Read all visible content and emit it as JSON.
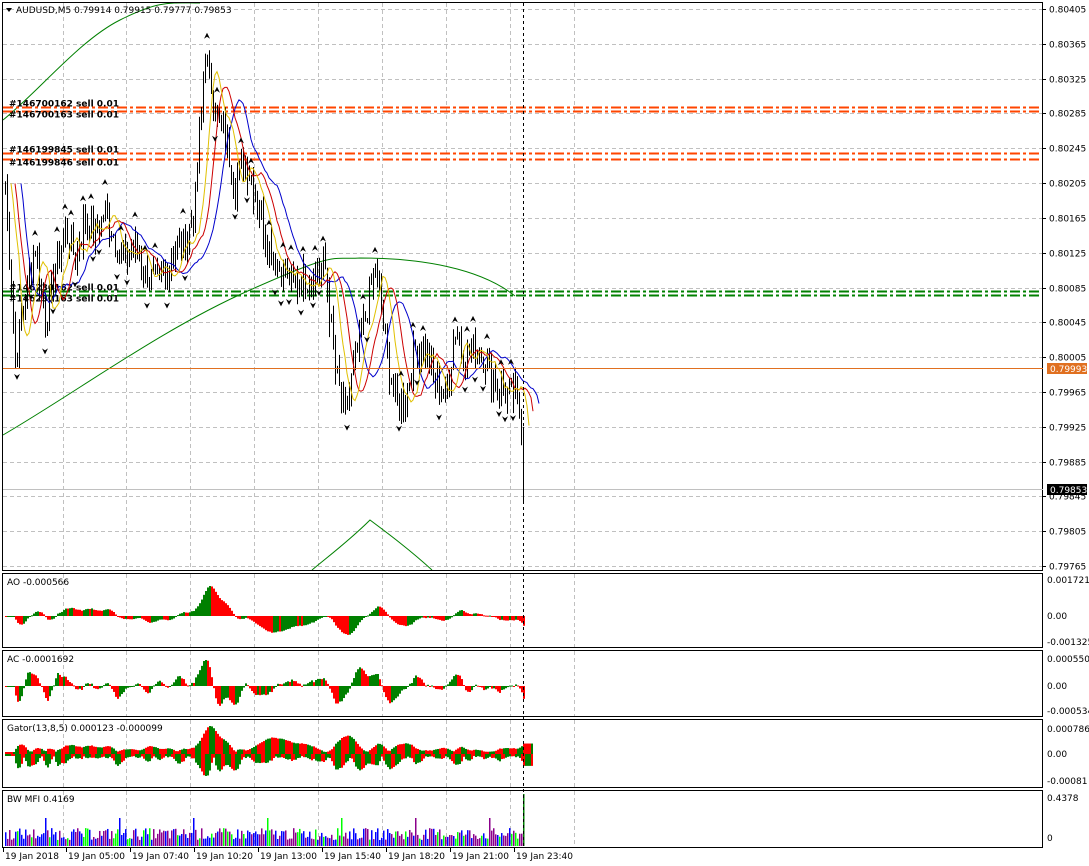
{
  "chart_data": {
    "type": "line",
    "symbol": "AUDUSD,M5",
    "title": "AUDUSD,M5  0.79914 0.79915 0.79777 0.79853",
    "ohlc": {
      "open": 0.79914,
      "high": 0.79915,
      "low": 0.79777,
      "close": 0.79853
    },
    "price_ticks": [
      "0.80405",
      "0.80365",
      "0.80325",
      "0.80285",
      "0.80245",
      "0.80205",
      "0.80165",
      "0.80125",
      "0.80085",
      "0.80045",
      "0.80005",
      "0.79965",
      "0.79925",
      "0.79885",
      "0.79845",
      "0.79805",
      "0.79765"
    ],
    "ylim": [
      0.79765,
      0.80405
    ],
    "x_ticks": [
      "19 Jan 2018",
      "19 Jan 05:00",
      "19 Jan 07:40",
      "19 Jan 10:20",
      "19 Jan 13:00",
      "19 Jan 15:40",
      "19 Jan 18:20",
      "19 Jan 21:00",
      "19 Jan 23:40"
    ],
    "current_price": {
      "label": "0.79853",
      "value": 0.79853
    },
    "order_line": {
      "label": "0.79993",
      "value": 0.79993
    },
    "order_levels": [
      {
        "label": "#146700162 sell 0.01",
        "price": 0.80292,
        "color": "#ff4500"
      },
      {
        "label": "#146700163 sell 0.01",
        "price": 0.80288,
        "color": "#ff4500"
      },
      {
        "label": "#146199845 sell 0.01",
        "price": 0.80239,
        "color": "#ff4500"
      },
      {
        "label": "#146199846 sell 0.01",
        "price": 0.80233,
        "color": "#ff4500"
      },
      {
        "label": "#146230162 sell 0.01",
        "price": 0.80081,
        "color": "#008000"
      },
      {
        "label": "#146230163 sell 0.01",
        "price": 0.80076,
        "color": "#008000"
      }
    ],
    "grid": true,
    "colors": {
      "candle": "#000000",
      "grid": "#c0c0c0",
      "ma_red": "#cc0000",
      "ma_blue": "#0000cc",
      "ma_gold": "#e0c000",
      "bands": "#008000",
      "order_line": "#e07020",
      "bull": "#008000",
      "bear": "#ff0000",
      "current_box": "#000000"
    },
    "subwindows": [
      {
        "id": "ao",
        "label": "AO -0.000566",
        "ticks": [
          "0.001721",
          "0.00",
          "-0.001325"
        ],
        "ylim": [
          -0.001325,
          0.001721
        ]
      },
      {
        "id": "ac",
        "label": "AC -0.0001692",
        "ticks": [
          "0.000550",
          "0.00",
          "-0.000534"
        ],
        "ylim": [
          -0.000534,
          0.00055
        ]
      },
      {
        "id": "gator",
        "label": "Gator(13,8,5) 0.000123 -0.000099",
        "ticks": [
          "0.000786",
          "0.00",
          "-0.00081"
        ],
        "ylim": [
          -0.00081,
          0.000786
        ]
      },
      {
        "id": "mfi",
        "label": "BW MFI 0.4169",
        "ticks": [
          "0.4378",
          "0"
        ],
        "ylim": [
          0,
          0.4378
        ]
      }
    ],
    "key_prices": [
      [
        0,
        0.80205
      ],
      [
        5,
        0.80005
      ],
      [
        10,
        0.80075
      ],
      [
        15,
        0.80135
      ],
      [
        20,
        0.80045
      ],
      [
        25,
        0.80105
      ],
      [
        30,
        0.8015
      ],
      [
        35,
        0.8012
      ],
      [
        40,
        0.80165
      ],
      [
        45,
        0.80145
      ],
      [
        50,
        0.80175
      ],
      [
        55,
        0.8014
      ],
      [
        60,
        0.80115
      ],
      [
        65,
        0.80135
      ],
      [
        70,
        0.801
      ],
      [
        75,
        0.80095
      ],
      [
        80,
        0.80095
      ],
      [
        85,
        0.80135
      ],
      [
        90,
        0.80135
      ],
      [
        95,
        0.80185
      ],
      [
        100,
        0.80355
      ],
      [
        105,
        0.8029
      ],
      [
        110,
        0.80255
      ],
      [
        115,
        0.80205
      ],
      [
        120,
        0.8023
      ],
      [
        125,
        0.80195
      ],
      [
        130,
        0.80145
      ],
      [
        135,
        0.80115
      ],
      [
        140,
        0.801
      ],
      [
        145,
        0.8009
      ],
      [
        150,
        0.80095
      ],
      [
        155,
        0.80105
      ],
      [
        160,
        0.80105
      ],
      [
        165,
        0.7999
      ],
      [
        170,
        0.79935
      ],
      [
        175,
        0.80005
      ],
      [
        180,
        0.8005
      ],
      [
        185,
        0.8011
      ],
      [
        190,
        0.8002
      ],
      [
        195,
        0.79955
      ],
      [
        200,
        0.7996
      ],
      [
        205,
        0.80015
      ],
      [
        210,
        0.8001
      ],
      [
        215,
        0.79975
      ],
      [
        220,
        0.7996
      ],
      [
        225,
        0.80035
      ],
      [
        230,
        0.80005
      ],
      [
        235,
        0.80015
      ],
      [
        240,
        0.80005
      ],
      [
        245,
        0.79975
      ],
      [
        250,
        0.79965
      ],
      [
        255,
        0.7996
      ],
      [
        258,
        0.7993
      ],
      [
        259,
        0.79853
      ]
    ]
  }
}
